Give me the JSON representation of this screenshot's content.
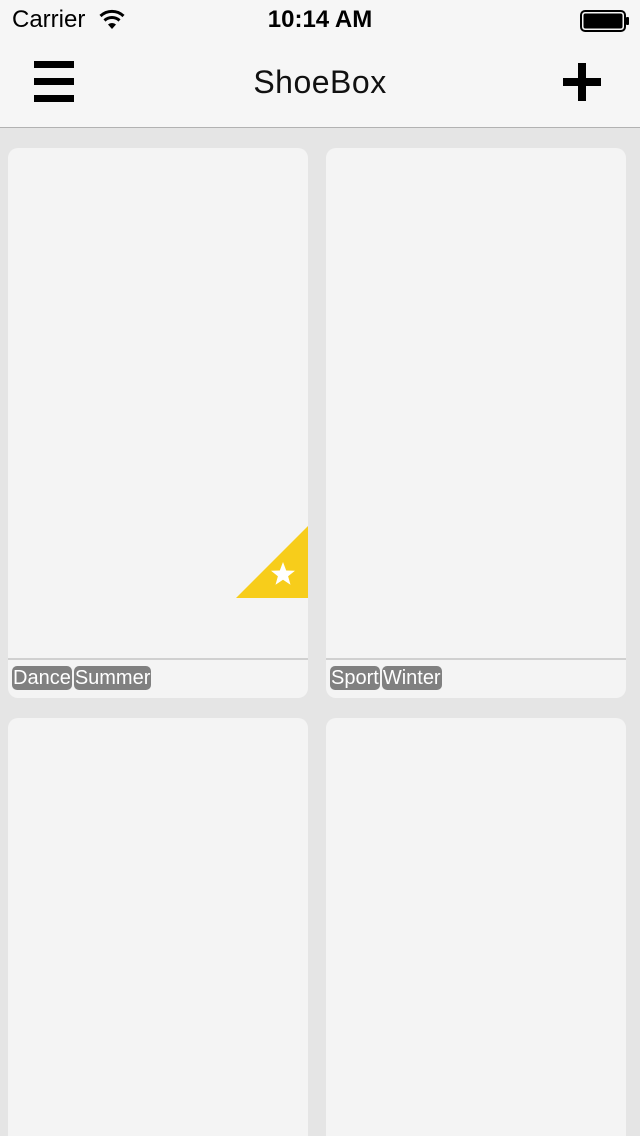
{
  "status_bar": {
    "carrier": "Carrier",
    "time": "10:14 AM",
    "wifi_icon": "wifi-icon",
    "battery_icon": "battery-icon"
  },
  "nav": {
    "title": "ShoeBox",
    "menu_icon": "hamburger-menu-icon",
    "add_icon": "plus-icon"
  },
  "cards": [
    {
      "favorite": true,
      "tags": [
        "Dance",
        "Summer"
      ]
    },
    {
      "favorite": false,
      "tags": [
        "Sport",
        "Winter"
      ]
    },
    {
      "favorite": false,
      "tags": []
    },
    {
      "favorite": false,
      "tags": []
    }
  ],
  "colors": {
    "background": "#e5e5e5",
    "bar": "#f6f6f6",
    "card": "#f4f4f4",
    "tag": "#808080",
    "favorite": "#f7cd1b"
  }
}
